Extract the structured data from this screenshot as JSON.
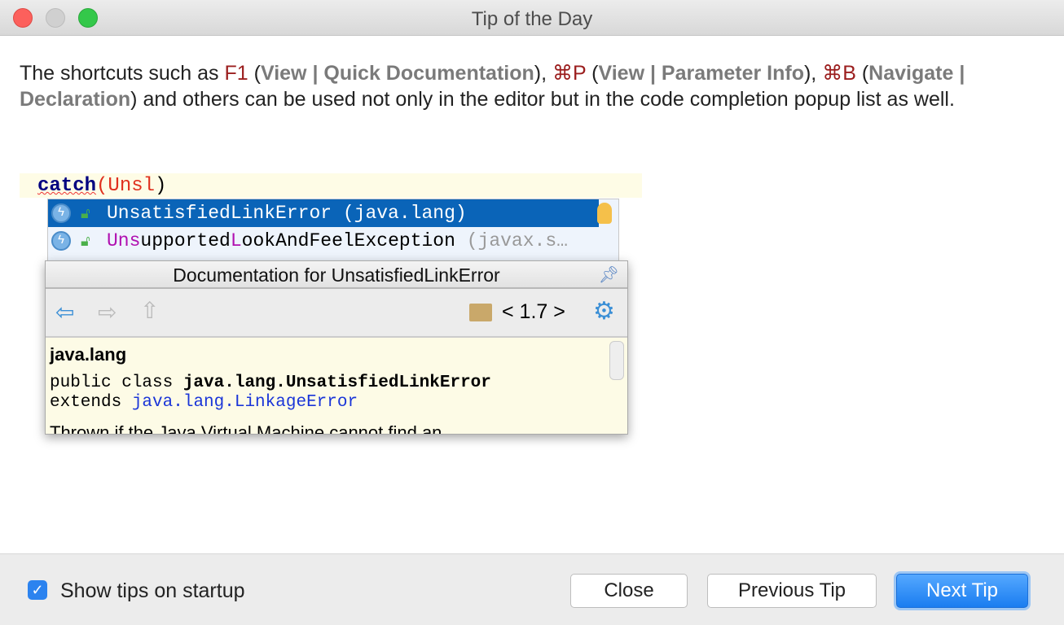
{
  "window": {
    "title": "Tip of the Day"
  },
  "tip": {
    "t1": "The shortcuts such as ",
    "k1": "F1",
    "t2": " (",
    "m1": "View | Quick Documentation",
    "t3": "), ",
    "k2": "⌘P",
    "t4": " (",
    "m2": "View | Parameter Info",
    "t5": "), ",
    "k3": "⌘B",
    "t6": " (",
    "m3": "Navigate | Declaration",
    "t7": ") and others can be used not only in the editor but in the code completion popup list as well."
  },
  "editor": {
    "keyword": "catch",
    "open": "(",
    "typed": "Unsl",
    "close": ")"
  },
  "completion": {
    "items": [
      {
        "name": "UnsatisfiedLinkError",
        "pkg": " (java.lang)"
      },
      {
        "name_a": "Uns",
        "name_b": "upported",
        "name_c": "L",
        "name_d": "ookAndFeelException",
        "pkg": " (javax.s…"
      }
    ]
  },
  "doc": {
    "title": "Documentation for UnsatisfiedLinkError",
    "version": "< 1.7 >",
    "package": "java.lang",
    "decl_prefix": "public class ",
    "decl_class": "java.lang.UnsatisfiedLinkError",
    "extends": "extends ",
    "extends_link": "java.lang.LinkageError",
    "desc": "Thrown if the Java Virtual Machine cannot find an"
  },
  "footer": {
    "show_tips_label": "Show tips on startup",
    "show_tips_checked": true,
    "close": "Close",
    "previous": "Previous Tip",
    "next": "Next Tip"
  }
}
